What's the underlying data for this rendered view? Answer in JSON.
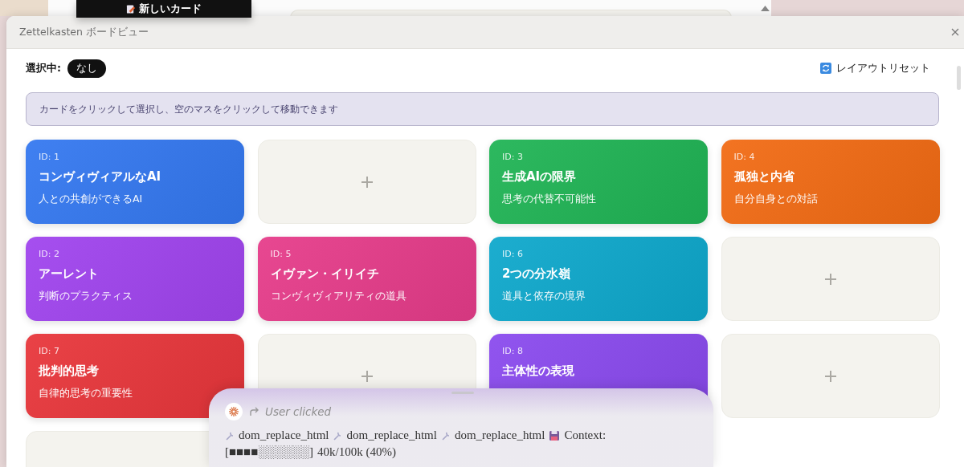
{
  "background_window": {
    "new_card_button": "新しいカード"
  },
  "dialog": {
    "title": "Zettelkasten ボードビュー",
    "selection_label": "選択中:",
    "selection_value": "なし",
    "reset_button": "レイアウトリセット",
    "hint": "カードをクリックして選択し、空のマスをクリックして移動できます",
    "cells": [
      {
        "kind": "card",
        "id_label": "ID: 1",
        "title": "コンヴィヴィアルなAI",
        "subtitle": "人との共創ができるAI",
        "color": "#3478f0"
      },
      {
        "kind": "empty"
      },
      {
        "kind": "card",
        "id_label": "ID: 3",
        "title": "生成AIの限界",
        "subtitle": "思考の代替不可能性",
        "color": "#20b455"
      },
      {
        "kind": "card",
        "id_label": "ID: 4",
        "title": "孤独と内省",
        "subtitle": "自分自身との対話",
        "color": "#f26b14"
      },
      {
        "kind": "card",
        "id_label": "ID: 2",
        "title": "アーレント",
        "subtitle": "判断のプラクティス",
        "color": "#a044ee"
      },
      {
        "kind": "card",
        "id_label": "ID: 5",
        "title": "イヴァン・イリイチ",
        "subtitle": "コンヴィヴィアリティの道具",
        "color": "#e63c8a"
      },
      {
        "kind": "card",
        "id_label": "ID: 6",
        "title": "2つの分水嶺",
        "subtitle": "道具と依存の境界",
        "color": "#0ea8cc"
      },
      {
        "kind": "empty"
      },
      {
        "kind": "card",
        "id_label": "ID: 7",
        "title": "批判的思考",
        "subtitle": "自律的思考の重要性",
        "color": "#e8363b"
      },
      {
        "kind": "empty"
      },
      {
        "kind": "card",
        "id_label": "ID: 8",
        "title": "主体性の表現",
        "color": "#8a4aee"
      },
      {
        "kind": "empty"
      },
      {
        "kind": "empty"
      }
    ]
  },
  "chat_panel": {
    "event": "User clicked",
    "tool_calls": [
      "dom_replace_html",
      "dom_replace_html",
      "dom_replace_html"
    ],
    "context_label": "Context:",
    "context_bar": "[■■■■░░░░░░]",
    "context_reading": "40k/100k (40%)"
  }
}
